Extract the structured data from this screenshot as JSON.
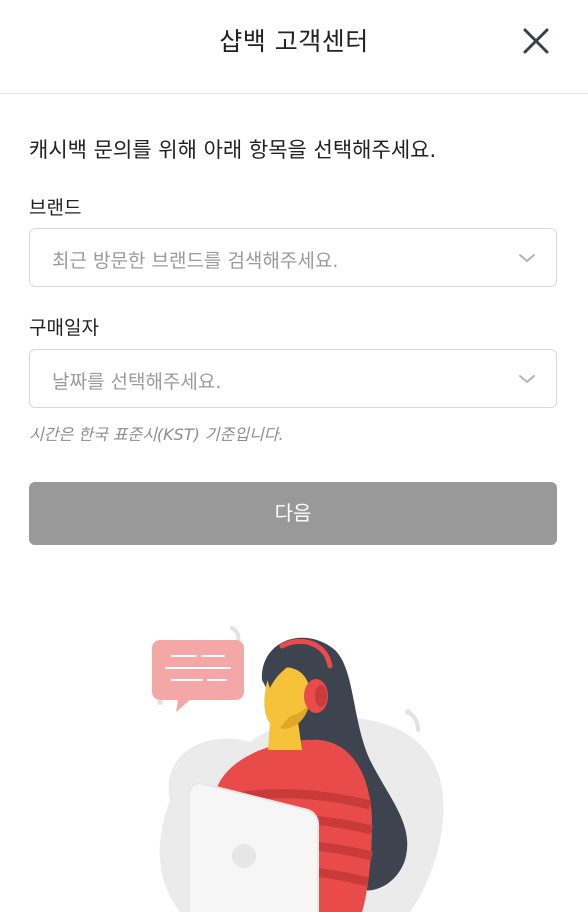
{
  "header": {
    "title": "샵백 고객센터",
    "close_icon": "close-icon"
  },
  "intro": "캐시백 문의를 위해 아래 항목을 선택해주세요.",
  "brand": {
    "label": "브랜드",
    "placeholder": "최근 방문한 브랜드를 검색해주세요."
  },
  "purchase_date": {
    "label": "구매일자",
    "placeholder": "날짜를 선택해주세요.",
    "note": "시간은 한국 표준시(KST) 기준입니다."
  },
  "next_button": {
    "label": "다음",
    "color": "#999999"
  },
  "colors": {
    "accent_red": "#e94b4b",
    "skin": "#f5c23a",
    "hair": "#3e4350",
    "bubble": "#f4a7a7"
  }
}
